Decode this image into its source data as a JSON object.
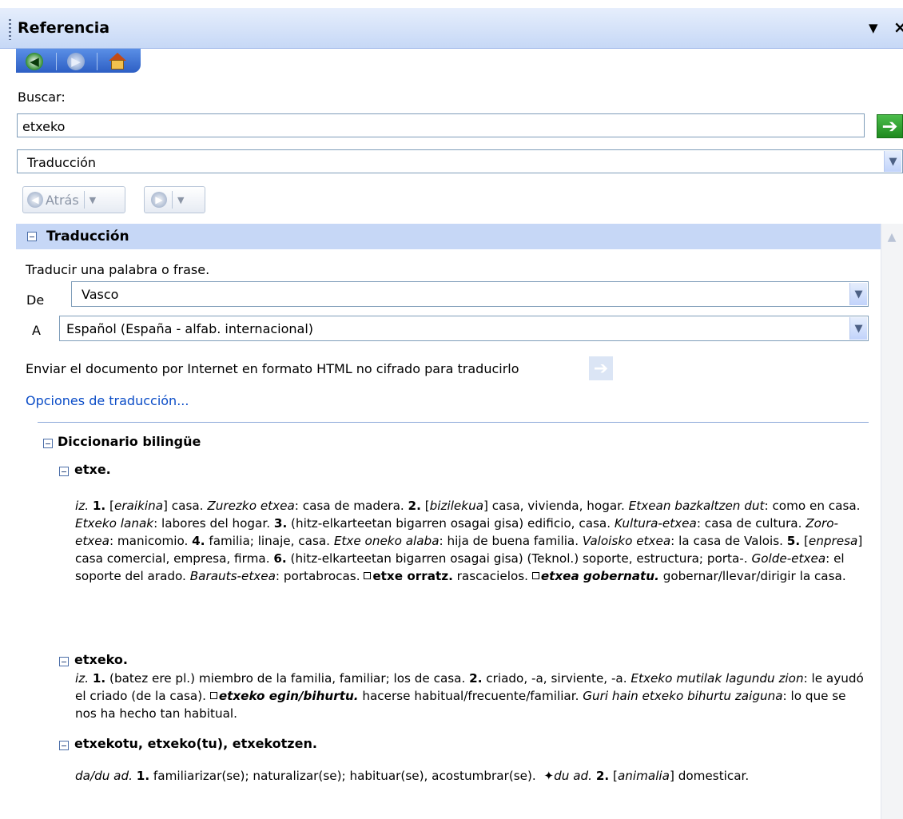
{
  "panel": {
    "title": "Referencia",
    "dropdown_glyph": "▼",
    "close_glyph": "×"
  },
  "nav": {
    "back_icon": "back-icon",
    "forward_icon": "forward-icon",
    "home_icon": "home-icon"
  },
  "search": {
    "label": "Buscar:",
    "value": "etxeko",
    "service_value": "Traducción"
  },
  "toolbar": {
    "back_label": "Atrás"
  },
  "translation": {
    "section_title": "Traducción",
    "description": "Traducir una palabra o frase.",
    "from_label": "De",
    "from_value": "Vasco",
    "to_label": "A",
    "to_value": "Español (España - alfab. internacional)",
    "send_text": "Enviar el documento por Internet en formato HTML no cifrado para traducirlo",
    "options_link": "Opciones de traducción..."
  },
  "dictionary": {
    "title": "Diccionario bilingüe",
    "entries": [
      {
        "headword": "etxe.",
        "body_html": "<i>iz.</i> <b>1.</b> [<i>eraikina</i>] casa. <i>Zurezko etxea</i>: casa de madera. <b>2.</b> [<i>bizilekua</i>] casa, vivienda, hogar. <i>Etxean bazkaltzen dut</i>: como en casa. <i>Etxeko lanak</i>: labores del hogar. <b>3.</b> (hitz-elkarteetan bigarren osagai gisa) edificio, casa. <i>Kultura-etxea</i>: casa de cultura. <i>Zoro-etxea</i>: manicomio. <b>4.</b> familia; linaje, casa. <i>Etxe oneko alaba</i>: hija de buena familia. <i>Valoisko etxea</i>: la casa de Valois. <b>5.</b> [<i>enpresa</i>] casa comercial, empresa, firma. <b>6.</b> (hitz-elkarteetan bigarren osagai gisa) (Teknol.) soporte, estructura; porta-. <i>Golde-etxea</i>: el soporte del arado. <i>Barauts-etxea</i>: portabrocas. <span class=\"sqbullet\"></span><b>etxe orratz.</b> rascacielos. <span class=\"sqbullet\"></span><b><i>etxea gobernatu.</i></b> gobernar/llevar/dirigir la casa."
      },
      {
        "headword": "etxeko.",
        "body_html": "<i>iz.</i> <b>1.</b> (batez ere pl.) miembro de la familia, familiar; los de casa. <b>2.</b> criado, -a, sirviente, -a. <i>Etxeko mutilak lagundu zion</i>: le ayudó el criado (de la casa). <span class=\"sqbullet\"></span><b><i>etxeko egin/bihurtu.</i></b> hacerse habitual/frecuente/familiar. <i>Guri hain etxeko bihurtu zaiguna</i>: lo que se nos ha hecho tan habitual."
      },
      {
        "headword": "etxekotu, etxeko(tu), etxekotzen.",
        "body_html": "<i>da/du ad.</i> <b>1.</b> familiarizar(se); naturalizar(se); habituar(se), acostumbrar(se). &nbsp;✦<i>du ad.</i> <b>2.</b> [<i>animalia</i>] domesticar."
      }
    ]
  }
}
